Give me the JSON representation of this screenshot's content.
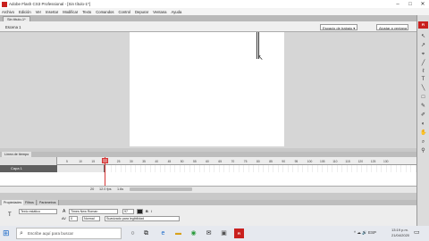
{
  "window": {
    "title": "Adobe Flash CS3 Professional - [Sin título-1*]",
    "controls": [
      "–",
      "□",
      "✕"
    ]
  },
  "menu": [
    "Archivo",
    "Edición",
    "Ver",
    "Insertar",
    "Modificar",
    "Texto",
    "Comandos",
    "Control",
    "Depurar",
    "Ventana",
    "Ayuda"
  ],
  "document": {
    "tab": "Sin título-1*",
    "scene": "Escena 1",
    "workspace": "Espacio de trabajo ▾",
    "zoom": "Ajustar a ventana"
  },
  "tools": {
    "badge": "Fl",
    "icons": [
      "↖",
      "↗",
      "⌖",
      "╱",
      "ℓ",
      "T",
      "╲",
      "□",
      "✎",
      "✐",
      "◐",
      "✋",
      "⌕",
      "⚲"
    ]
  },
  "timeline": {
    "tab": "Línea de tiempo",
    "layer": "Capa 1",
    "ticks": [
      "5",
      "10",
      "15",
      "20",
      "25",
      "30",
      "35",
      "40",
      "45",
      "50",
      "55",
      "60",
      "65",
      "70",
      "75",
      "80",
      "85",
      "90",
      "95",
      "100",
      "105",
      "110",
      "115",
      "120",
      "125",
      "130"
    ],
    "status": {
      "frame": "20",
      "fps": "12.0 fps",
      "time": "1.6s"
    }
  },
  "properties": {
    "tabs": [
      "Propiedades",
      "Filtros",
      "Parámetros"
    ],
    "text_type": "Texto estático",
    "font": "Times New Roman",
    "size": "97",
    "letter_spacing": "0",
    "alignment_label": "Normal",
    "anti_alias": "Suavizado para legibilidad"
  },
  "taskbar": {
    "search_placeholder": "Escribe aquí para buscar",
    "tray": "^ ☁ 🔊 ESP",
    "time": "13:19 p.m.",
    "date": "21/04/2020"
  }
}
